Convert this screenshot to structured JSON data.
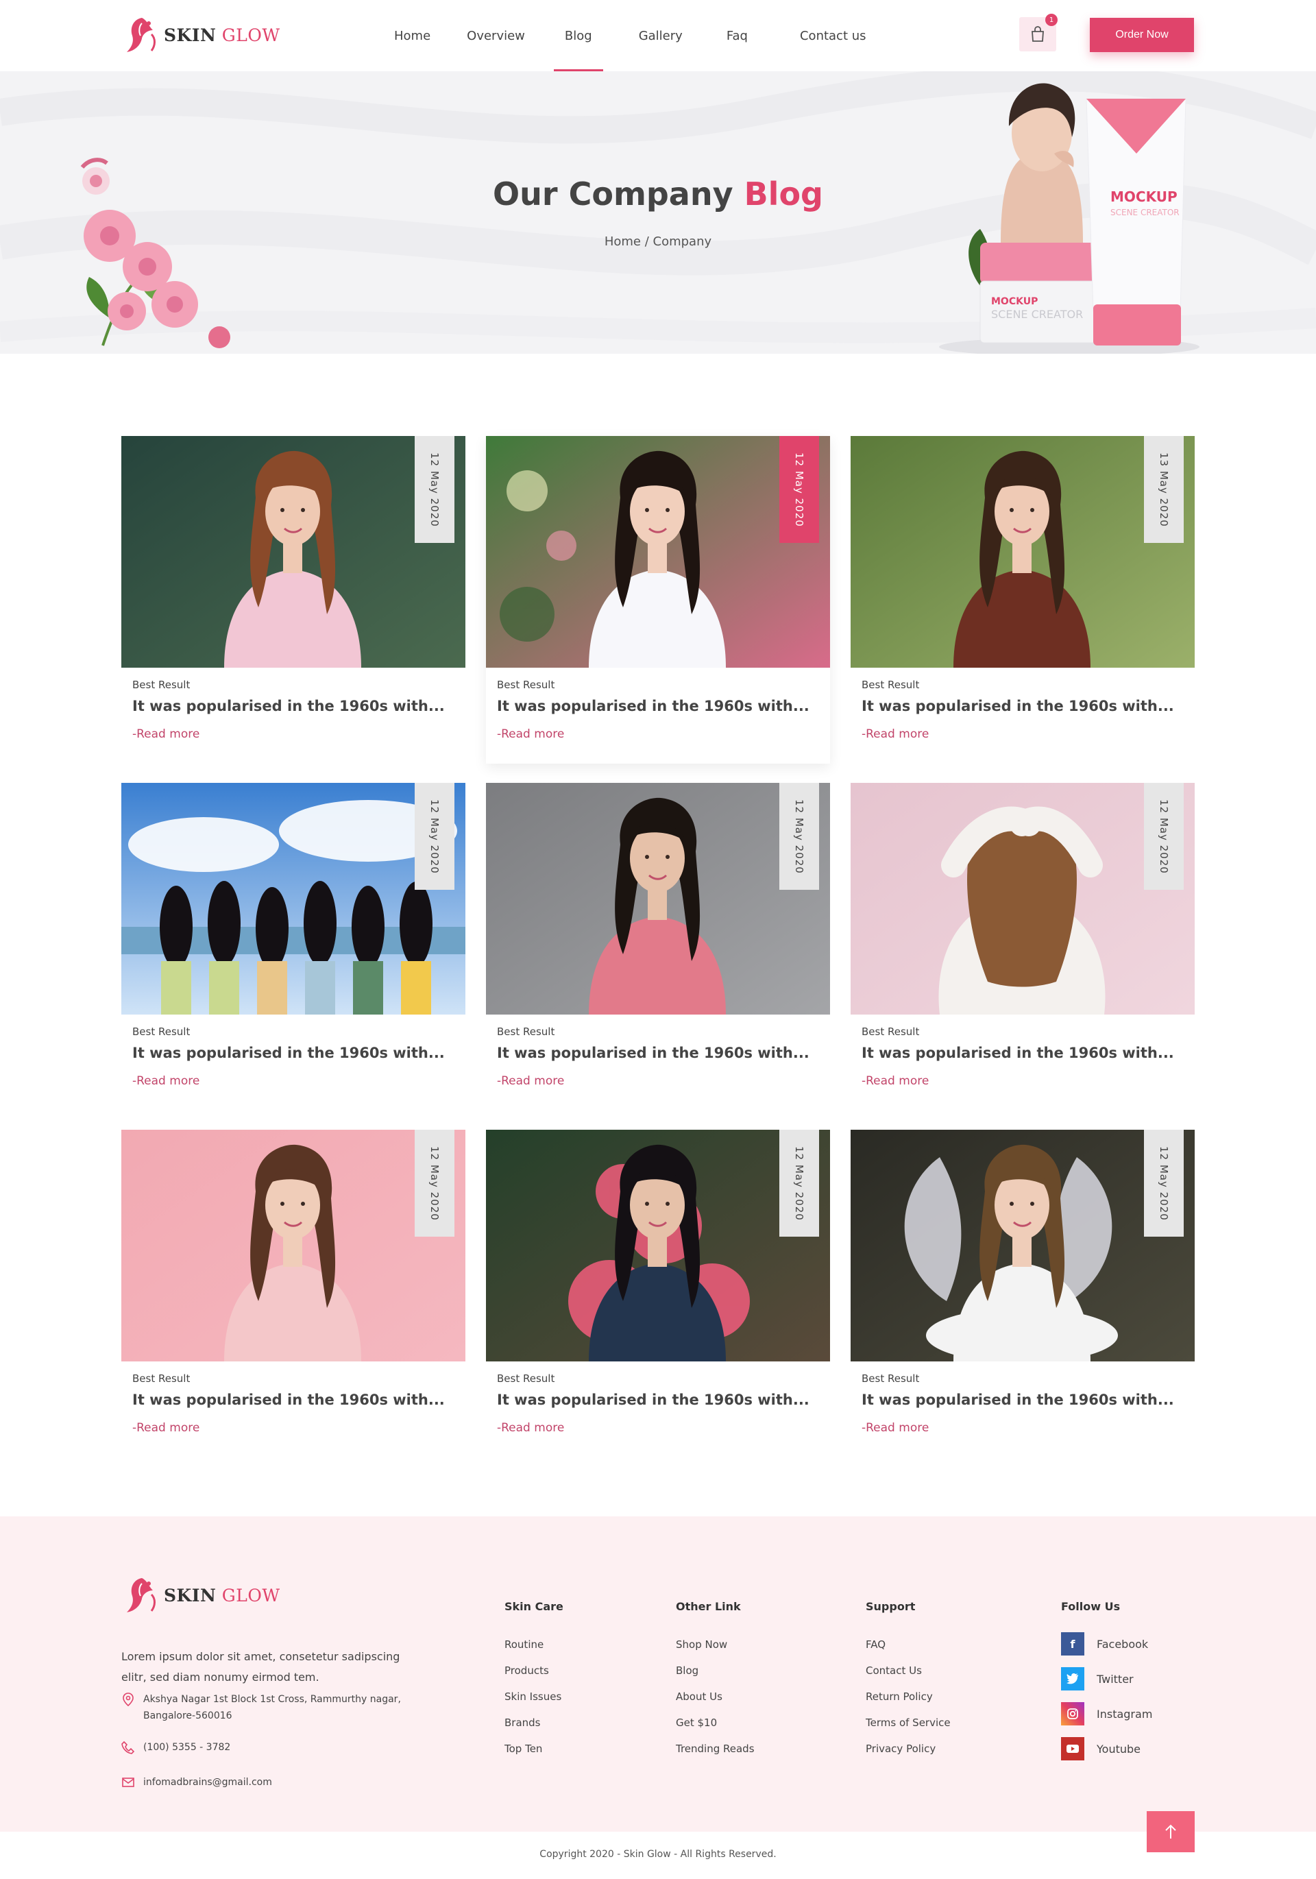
{
  "brand": {
    "name_bold": "SKIN",
    "name_light": "GLOW"
  },
  "nav": {
    "items": [
      "Home",
      "Overview",
      "Blog",
      "Gallery",
      "Faq",
      "Contact us"
    ],
    "active": "Blog",
    "cart_count": "1",
    "order_label": "Order Now"
  },
  "hero": {
    "title_main": "Our Company",
    "title_accent": "Blog",
    "breadcrumb_home": "Home",
    "breadcrumb_sep": " / ",
    "breadcrumb_current": "Company",
    "product_label": "MOCKUP",
    "product_sub": "SCENE CREATOR",
    "jar_label": "MOCKUP",
    "jar_sub": "SCENE CREATOR"
  },
  "posts": [
    {
      "date": "12 May 2020",
      "category": "Best Result",
      "title": "It was popularised in the 1960s with...",
      "more": "-Read more",
      "scene": "green",
      "highlight": false
    },
    {
      "date": "12 May 2020",
      "category": "Best Result",
      "title": "It was popularised in the 1960s with...",
      "more": "-Read more",
      "scene": "bokeh",
      "highlight": true
    },
    {
      "date": "13 May 2020",
      "category": "Best Result",
      "title": "It was popularised in the 1960s with...",
      "more": "-Read more",
      "scene": "grass",
      "highlight": false
    },
    {
      "date": "12 May 2020",
      "category": "Best Result",
      "title": "It was popularised in the 1960s with...",
      "more": "-Read more",
      "scene": "sky",
      "highlight": false
    },
    {
      "date": "12 May 2020",
      "category": "Best Result",
      "title": "It was popularised in the 1960s with...",
      "more": "-Read more",
      "scene": "grey",
      "highlight": false
    },
    {
      "date": "12 May 2020",
      "category": "Best Result",
      "title": "It was popularised in the 1960s with...",
      "more": "-Read more",
      "scene": "pinkwall",
      "highlight": false
    },
    {
      "date": "12 May 2020",
      "category": "Best Result",
      "title": "It was popularised in the 1960s with...",
      "more": "-Read more",
      "scene": "pinkbg",
      "highlight": false
    },
    {
      "date": "12 May 2020",
      "category": "Best Result",
      "title": "It was popularised in the 1960s with...",
      "more": "-Read more",
      "scene": "smoke",
      "highlight": false
    },
    {
      "date": "12 May 2020",
      "category": "Best Result",
      "title": "It was popularised in the 1960s with...",
      "more": "-Read more",
      "scene": "forest",
      "highlight": false
    }
  ],
  "footer": {
    "about": "Lorem ipsum dolor sit amet, consetetur sadipscing elitr, sed diam nonumy eirmod tem.",
    "address": "Akshya Nagar 1st Block 1st Cross, Rammurthy nagar, Bangalore-560016",
    "phone": "(100) 5355 - 3782",
    "email": "infomadbrains@gmail.com",
    "columns": [
      {
        "heading": "Skin Care",
        "links": [
          "Routine",
          "Products",
          "Skin Issues",
          "Brands",
          "Top Ten"
        ]
      },
      {
        "heading": "Other Link",
        "links": [
          "Shop Now",
          "Blog",
          "About Us",
          "Get $10",
          "Trending Reads"
        ]
      },
      {
        "heading": "Support",
        "links": [
          "FAQ",
          "Contact Us",
          "Return Policy",
          "Terms of Service",
          "Privacy Policy"
        ]
      }
    ],
    "social_heading": "Follow Us",
    "social": [
      {
        "label": "Facebook",
        "icon": "facebook-icon",
        "color": "#3b5998"
      },
      {
        "label": "Twitter",
        "icon": "twitter-icon",
        "color": "#1da1f2"
      },
      {
        "label": "Instagram",
        "icon": "instagram-icon",
        "color": "#e4405f"
      },
      {
        "label": "Youtube",
        "icon": "youtube-icon",
        "color": "#c4302b"
      }
    ],
    "copyright": "Copyright 2020 - Skin Glow - All Rights Reserved."
  },
  "colors": {
    "accent": "#e0446b",
    "footer_bg": "#fdf0f2",
    "hero_bg": "#f3f3f5"
  }
}
